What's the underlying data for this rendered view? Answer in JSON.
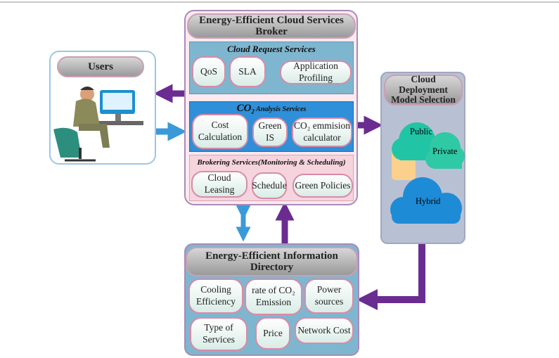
{
  "users": {
    "title": "Users"
  },
  "broker": {
    "title": "Energy-Efficient Cloud Services Broker",
    "request": {
      "title": "Cloud Request Services",
      "items": [
        "QoS",
        "SLA",
        "Application Profiling"
      ]
    },
    "co2": {
      "title_main": "CO",
      "title_sub": "2",
      "title_rest": " Analysis Services",
      "items": [
        "Cost Calculation",
        "Green IS",
        "CO₂ emmision calculator"
      ]
    },
    "brokering": {
      "title": "Brokering Services(Monitoring & Scheduling)",
      "items": [
        "Cloud Leasing",
        "Schedule",
        "Green Policies"
      ]
    }
  },
  "deployment": {
    "title": "Cloud Deployment Model Selection",
    "clouds": [
      "Public",
      "Private",
      "Hybrid"
    ]
  },
  "directory": {
    "title": "Energy-Efficient Information Directory",
    "items": [
      "Cooling Efficiency",
      "rate of CO₂ Emission",
      "Power sources",
      "Type of Services",
      "Price",
      "Network Cost"
    ]
  },
  "colors": {
    "purple_arrow": "#6a2c91",
    "blue_arrow": "#3a9ad9",
    "request_panel": "#7fb6cf",
    "co2_panel": "#2f8fd8",
    "brokering_panel": "#f6d4de",
    "cloud": "#22c4a6"
  }
}
